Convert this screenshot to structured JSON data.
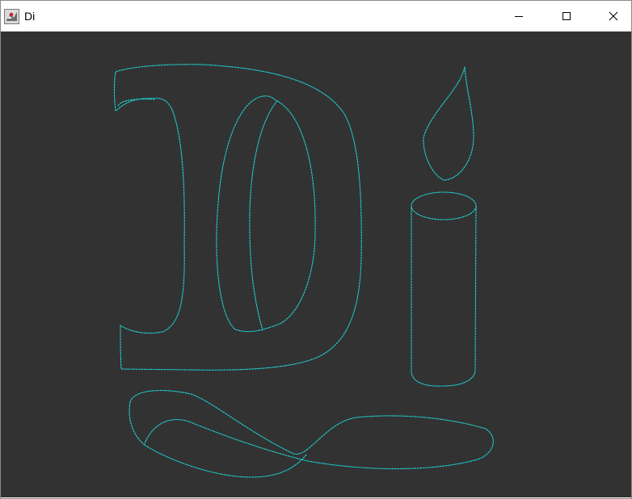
{
  "window": {
    "title": "Di",
    "icon": "java-app-icon"
  },
  "titlebar": {
    "buttons": [
      "minimize-icon",
      "maximize-icon",
      "close-icon"
    ]
  },
  "canvas": {
    "background": "#323232",
    "stroke_color": "#1fd4d4",
    "shapes": [
      "letter-d-outline",
      "letter-d-inner-ellipse",
      "candle-flame",
      "candle-body",
      "figure-eight-loop"
    ]
  },
  "colors": {
    "titlebar_bg": "#ffffff",
    "canvas_bg": "#323232",
    "drawing": "#1fd4d4"
  }
}
